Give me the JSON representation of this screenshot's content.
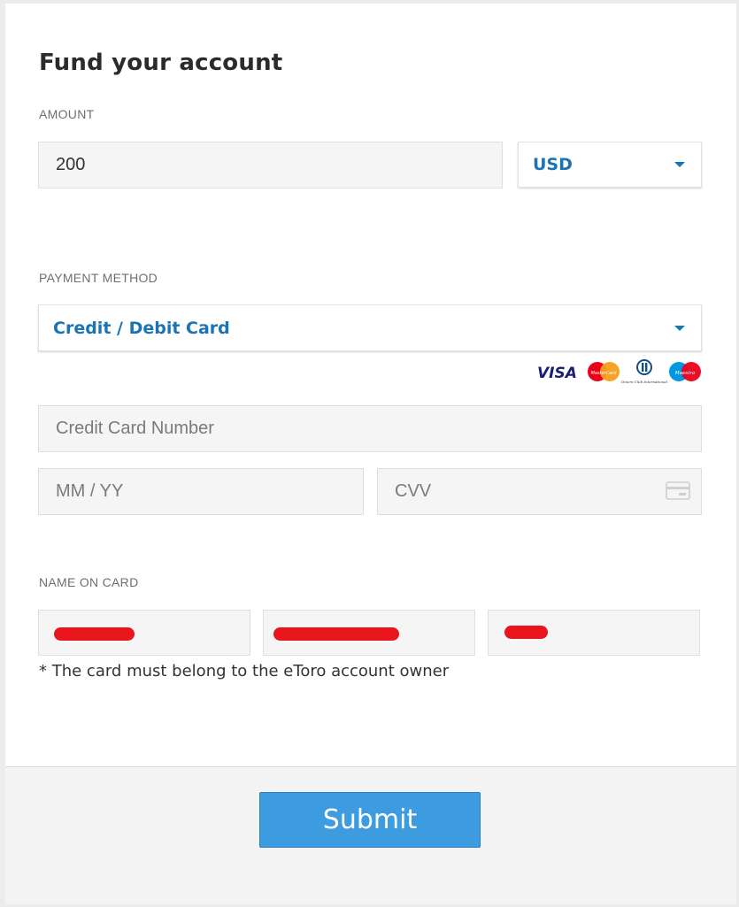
{
  "page": {
    "title": "Fund your account"
  },
  "amount": {
    "label": "AMOUNT",
    "value": "200",
    "currency": "USD"
  },
  "payment": {
    "label": "PAYMENT METHOD",
    "method": "Credit / Debit Card",
    "card_brands": [
      "VISA",
      "MasterCard",
      "Diners Club International",
      "Maestro"
    ]
  },
  "card": {
    "number_placeholder": "Credit Card Number",
    "expiry_placeholder": "MM / YY",
    "cvv_placeholder": "CVV"
  },
  "name_on_card": {
    "label": "NAME ON CARD",
    "note": "* The card must belong to the eToro account owner"
  },
  "actions": {
    "submit_label": "Submit"
  },
  "colors": {
    "accent": "#1a73b4",
    "button": "#3d9be0",
    "redaction": "#e8161c"
  }
}
